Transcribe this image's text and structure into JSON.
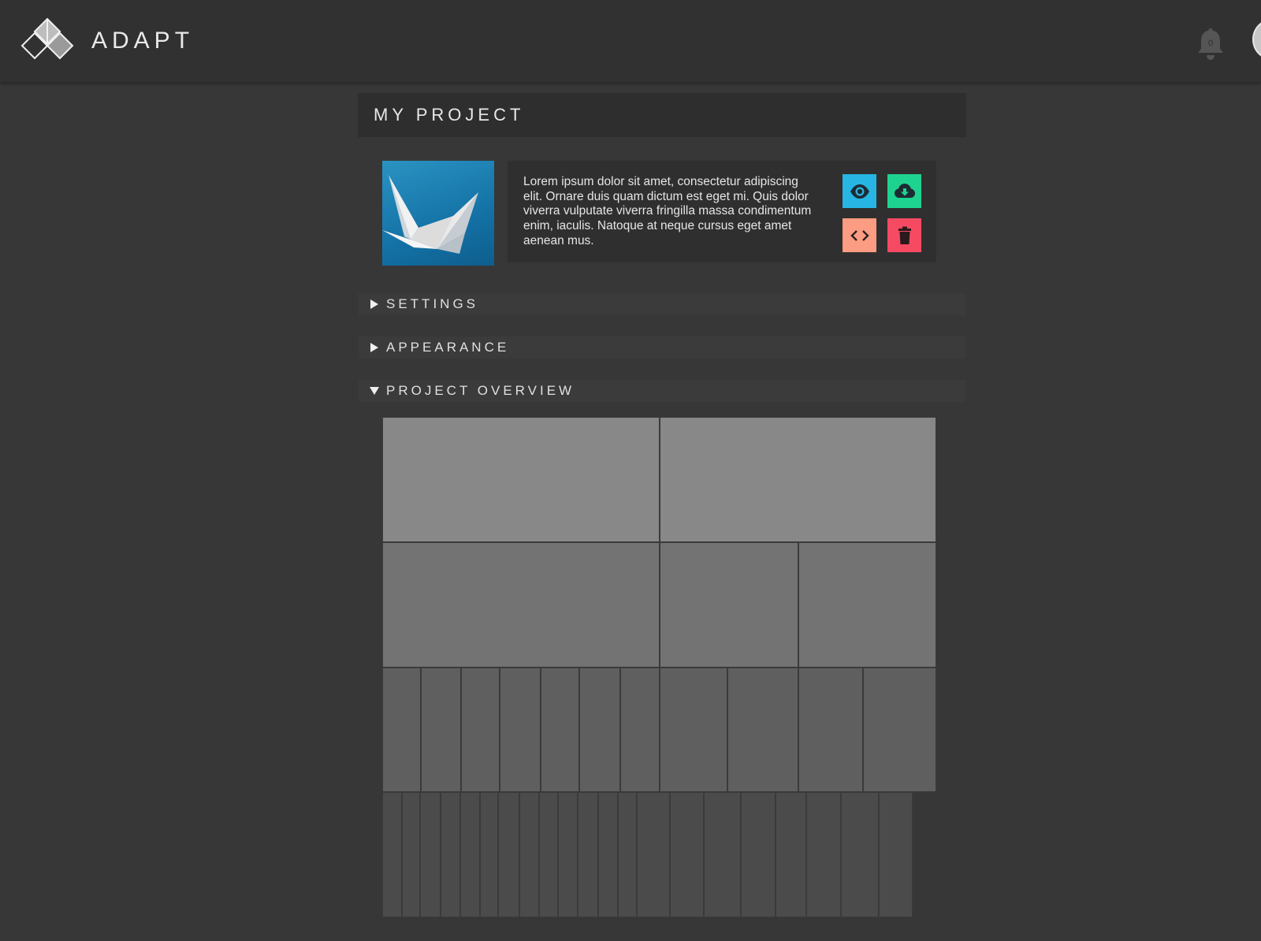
{
  "header": {
    "brand": "ADAPT",
    "notification_count": "0",
    "icons": {
      "logo": "diamond-logo-icon",
      "bell": "bell-icon",
      "avatar": "user-avatar"
    }
  },
  "project": {
    "title": "MY PROJECT",
    "description": "Lorem ipsum dolor sit amet, consectetur adipiscing elit. Ornare duis quam dictum est eget mi. Quis dolor viverra vulputate viverra fringilla massa condimentum enim, iaculis. Natoque at neque cursus eget amet aenean mus.",
    "actions": [
      {
        "name": "view",
        "icon": "eye-icon",
        "color": "#27b5e3"
      },
      {
        "name": "download",
        "icon": "cloud-download-icon",
        "color": "#1ed38f"
      },
      {
        "name": "embed",
        "icon": "code-icon",
        "color": "#fc9c82"
      },
      {
        "name": "delete",
        "icon": "trash-icon",
        "color": "#f54a62"
      }
    ]
  },
  "sections": [
    {
      "label": "SETTINGS",
      "expanded": false
    },
    {
      "label": "APPEARANCE",
      "expanded": false
    },
    {
      "label": "PROJECT OVERVIEW",
      "expanded": true
    }
  ],
  "overview": {
    "row_colors": [
      "#888888",
      "#737373",
      "#5f5f5f",
      "#4b4b4b"
    ],
    "rows": [
      {
        "cells": [
          352,
          351
        ]
      },
      {
        "cells": [
          352,
          176,
          175
        ]
      },
      {
        "cells": [
          49,
          51,
          49,
          52,
          49,
          52,
          50,
          86,
          90,
          82,
          93
        ]
      },
      {
        "cells": [
          25,
          23,
          26,
          25,
          25,
          23,
          27,
          25,
          24,
          25,
          26,
          25,
          24,
          42,
          43,
          47,
          44,
          39,
          44,
          48,
          43
        ]
      }
    ]
  },
  "colors": {
    "background": "#373737",
    "topbar": "#313131",
    "panel": "#2f2f2f",
    "section_bar": "#3b3b3b",
    "text": "#e6e6e6"
  }
}
